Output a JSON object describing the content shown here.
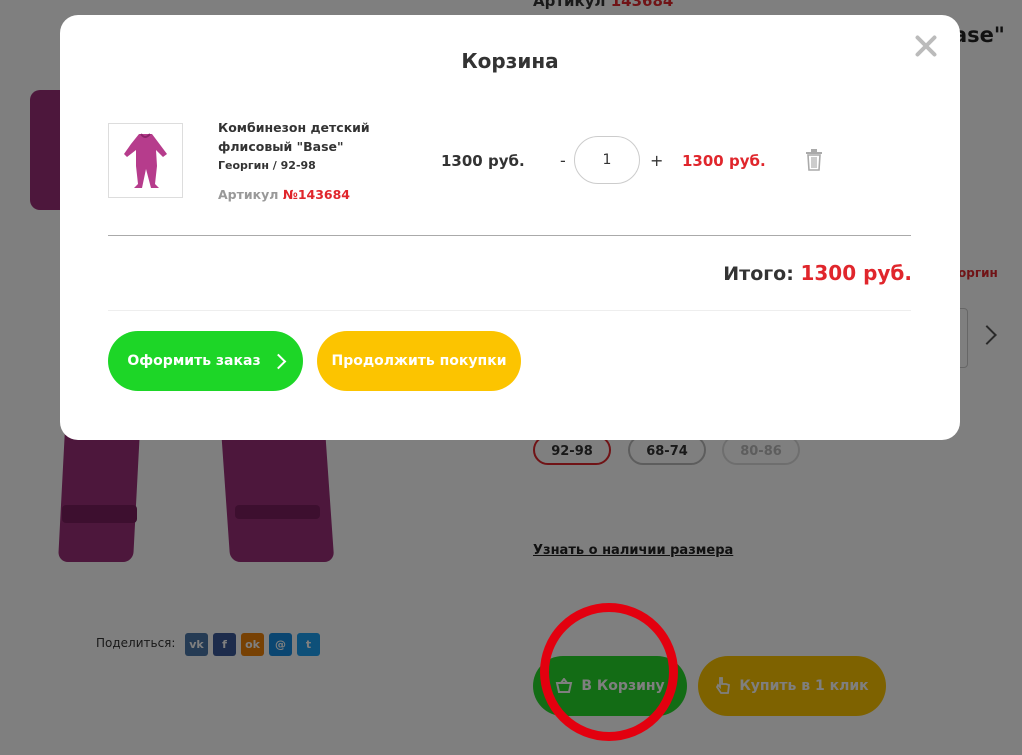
{
  "background_page": {
    "article_label": "Артикул",
    "article_number": "143684",
    "title_fragment": "ase\"",
    "color_fragment": "оргин",
    "sizes": [
      {
        "label": "92-98",
        "state": "selected"
      },
      {
        "label": "68-74",
        "state": "available"
      },
      {
        "label": "80-86",
        "state": "unavailable"
      }
    ],
    "size_availability_link": "Узнать о наличии размера",
    "share_label": "Поделиться:",
    "social_icons": [
      "vk-icon",
      "facebook-icon",
      "odnoklassniki-icon",
      "moimir-icon",
      "twitter-icon"
    ],
    "social_labels": {
      "vk": "vk",
      "facebook": "f",
      "odnoklassniki": "ok",
      "moimir": "@",
      "twitter": "t"
    },
    "add_to_cart_label": "В Корзину",
    "buy_one_click_label": "Купить в 1 клик",
    "highlight_annotation": "red-circle"
  },
  "modal": {
    "title": "Корзина",
    "item": {
      "name": "Комбинезон детский флисовый \"Base\"",
      "variant": "Георгин / 92-98",
      "article_label": "Артикул",
      "article_number": "№143684",
      "price": "1300 руб.",
      "qty_minus": "-",
      "qty": "1",
      "qty_plus": "+",
      "line_total": "1300 руб."
    },
    "total_label": "Итого:",
    "total_value": "1300 руб.",
    "checkout_label": "Оформить заказ",
    "continue_label": "Продолжить покупки"
  },
  "colors": {
    "accent_red": "#e0262c",
    "green": "#1dd627",
    "yellow": "#fcc400",
    "garment": "#9b2e78"
  }
}
